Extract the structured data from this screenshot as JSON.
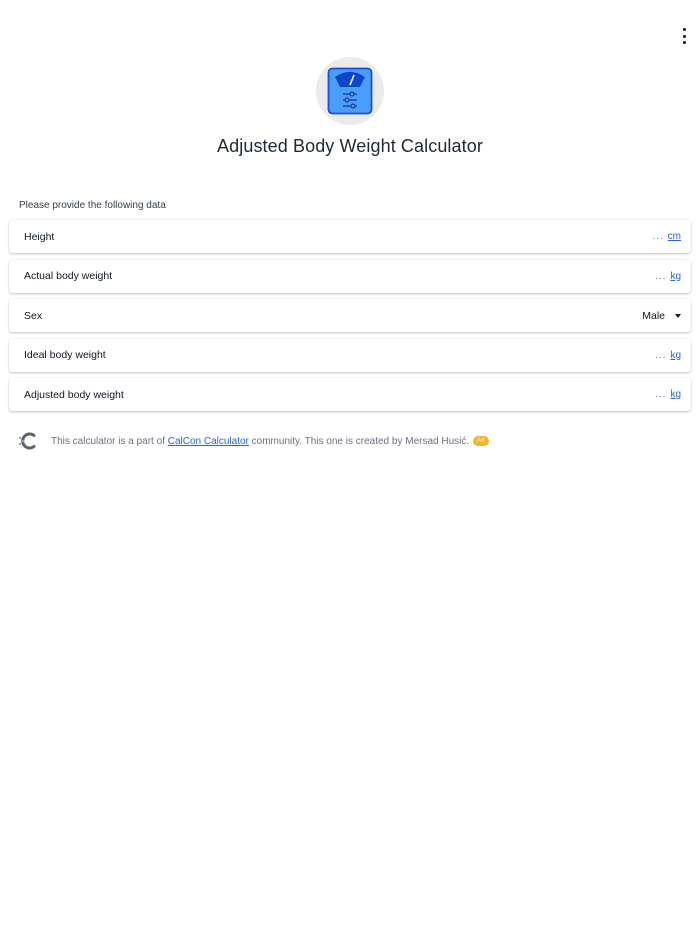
{
  "header": {
    "title": "Adjusted Body Weight Calculator",
    "menu_icon": "more-vertical-icon",
    "app_icon": "scale-icon"
  },
  "form": {
    "prompt": "Please provide the following data",
    "fields": [
      {
        "label": "Height",
        "value": "...",
        "unit": "cm"
      },
      {
        "label": "Actual body weight",
        "value": "...",
        "unit": "kg"
      },
      {
        "label": "Sex",
        "value": "Male"
      },
      {
        "label": "Ideal body weight",
        "value": "...",
        "unit": "kg"
      },
      {
        "label": "Adjusted body weight",
        "value": "...",
        "unit": "kg"
      }
    ]
  },
  "footer": {
    "text_before": "This calculator is a part of",
    "link": "CalCon Calculator",
    "text_after": "community. This one is created by Mersad Husić.",
    "badge": "Ad",
    "icon": "calcon-logo-icon"
  },
  "colors": {
    "accent": "#2563eb",
    "badge": "#f4b42d",
    "logo_bg": "#ebebeb"
  }
}
